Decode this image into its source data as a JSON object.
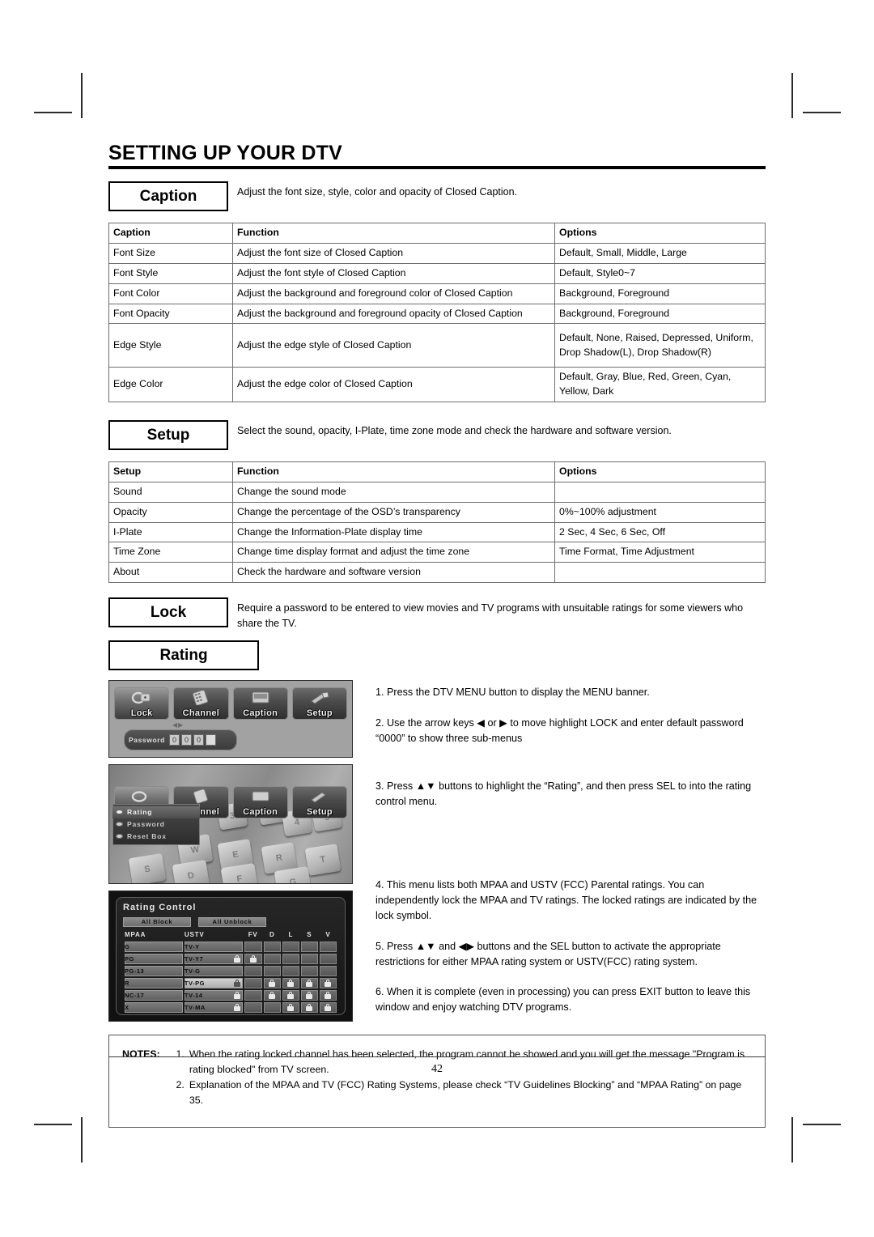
{
  "page_title": "SETTING UP YOUR DTV",
  "page_number": "42",
  "caption_section": {
    "label": "Caption",
    "description": "Adjust the font size, style, color and opacity of Closed Caption.",
    "headers": [
      "Caption",
      "Function",
      "Options"
    ],
    "rows": [
      {
        "name": "Font Size",
        "function": "Adjust the font size of Closed Caption",
        "options": "Default, Small, Middle, Large"
      },
      {
        "name": "Font Style",
        "function": "Adjust the font style of Closed Caption",
        "options": "Default, Style0~7"
      },
      {
        "name": "Font Color",
        "function": "Adjust the background and foreground color of Closed Caption",
        "options": "Background, Foreground"
      },
      {
        "name": "Font Opacity",
        "function": "Adjust the background and foreground opacity of Closed Caption",
        "options": "Background, Foreground"
      },
      {
        "name": "Edge Style",
        "function": "Adjust the edge style of Closed Caption",
        "options": "Default, None, Raised, Depressed, Uniform, Drop Shadow(L), Drop Shadow(R)"
      },
      {
        "name": "Edge Color",
        "function": "Adjust the edge color of Closed Caption",
        "options": "Default, Gray, Blue, Red, Green, Cyan, Yellow, Dark"
      }
    ]
  },
  "setup_section": {
    "label": "Setup",
    "description": "Select the sound, opacity, I-Plate, time zone mode and check the hardware and software version.",
    "headers": [
      "Setup",
      "Function",
      "Options"
    ],
    "rows": [
      {
        "name": "Sound",
        "function": "Change the sound mode",
        "options": ""
      },
      {
        "name": "Opacity",
        "function": "Change the percentage of the OSD’s transparency",
        "options": "0%~100% adjustment"
      },
      {
        "name": "I-Plate",
        "function": "Change the Information-Plate display time",
        "options": "2 Sec, 4 Sec, 6 Sec, Off"
      },
      {
        "name": "Time Zone",
        "function": "Change time display format and adjust the time zone",
        "options": "Time Format, Time Adjustment"
      },
      {
        "name": "About",
        "function": "Check the hardware and software version",
        "options": ""
      }
    ]
  },
  "lock_section": {
    "label": "Lock",
    "description": "Require a password to be entered to view movies and TV programs with unsuitable ratings for some viewers who share the TV.",
    "rating_label": "Rating",
    "steps": [
      "1. Press the DTV MENU button to display the MENU banner.",
      "2. Use the arrow keys ◀ or ▶ to move highlight LOCK and enter default password “0000” to show three sub-menus",
      "3. Press ▲▼ buttons to highlight the “Rating”, and then press SEL to into the rating control menu.",
      "4. This menu lists both MPAA and USTV (FCC) Parental ratings. You can independently lock the MPAA and TV ratings. The locked ratings are indicated by the lock symbol.",
      "5. Press ▲▼ and ◀▶ buttons and the SEL button to activate the appropriate restrictions for either MPAA rating system or USTV(FCC) rating system.",
      "6. When it is complete (even in processing) you can press EXIT button to leave this window and enjoy watching DTV programs."
    ]
  },
  "osd_banner": {
    "buttons": [
      "Lock",
      "Channel",
      "Caption",
      "Setup"
    ],
    "selected": "Lock",
    "password_label": "Password",
    "password_chars": [
      "0",
      "0",
      "0",
      ""
    ],
    "hint": "◀▶"
  },
  "osd_submenu": {
    "items": [
      "Rating",
      "Password",
      "Reset Box"
    ],
    "highlighted": "Rating",
    "keyboard_keys": [
      "3",
      "$",
      "4",
      "5",
      "W",
      "E",
      "R",
      "T",
      "S",
      "D",
      "F",
      "G"
    ]
  },
  "rating_control": {
    "title": "Rating Control",
    "all_block_label": "All Block",
    "all_unblock_label": "All Unblock",
    "headers": [
      "MPAA",
      "USTV",
      "FV",
      "D",
      "L",
      "S",
      "V"
    ],
    "rows": [
      {
        "mpaa": "G",
        "ustv": "TV-Y",
        "ustv_locked": false,
        "selected": false,
        "flags": [
          false,
          false,
          false,
          false,
          false
        ]
      },
      {
        "mpaa": "PG",
        "ustv": "TV-Y7",
        "ustv_locked": true,
        "selected": false,
        "flags": [
          true,
          false,
          false,
          false,
          false
        ]
      },
      {
        "mpaa": "PG-13",
        "ustv": "TV-G",
        "ustv_locked": false,
        "selected": false,
        "flags": [
          false,
          false,
          false,
          false,
          false
        ]
      },
      {
        "mpaa": "R",
        "ustv": "TV-PG",
        "ustv_locked": true,
        "selected": true,
        "flags": [
          false,
          true,
          true,
          true,
          true
        ]
      },
      {
        "mpaa": "NC-17",
        "ustv": "TV-14",
        "ustv_locked": true,
        "selected": false,
        "flags": [
          false,
          true,
          true,
          true,
          true
        ]
      },
      {
        "mpaa": "X",
        "ustv": "TV-MA",
        "ustv_locked": true,
        "selected": false,
        "flags": [
          false,
          false,
          true,
          true,
          true
        ]
      }
    ]
  },
  "notes": {
    "label": "NOTES:",
    "items": [
      {
        "num": "1.",
        "text": "When the rating locked channel has been selected, the program cannot be showed and you will get the message \"Program is rating blocked\" from TV screen."
      },
      {
        "num": "2.",
        "text": "Explanation of the MPAA and TV (FCC) Rating Systems, please check “TV Guidelines Blocking” and “MPAA Rating” on page 35."
      }
    ]
  }
}
